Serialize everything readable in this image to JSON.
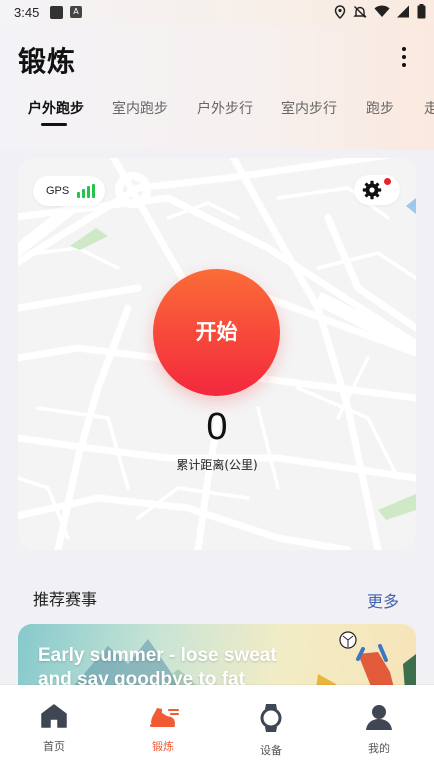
{
  "status_bar": {
    "time": "3:45",
    "icons": [
      "location-icon",
      "notifications-off-icon",
      "wifi-icon",
      "signal-icon",
      "battery-icon"
    ]
  },
  "header": {
    "title": "锻炼",
    "menu_icon": "more-vertical-icon"
  },
  "tabs": [
    {
      "label": "户外跑步",
      "active": true
    },
    {
      "label": "室内跑步",
      "active": false
    },
    {
      "label": "户外步行",
      "active": false
    },
    {
      "label": "室内步行",
      "active": false
    },
    {
      "label": "跑步",
      "active": false
    },
    {
      "label": "走",
      "active": false
    }
  ],
  "map_card": {
    "gps_label": "GPS",
    "gps_signal_bars": 4,
    "settings_has_notification": true,
    "start_label": "开始",
    "distance_value": "0",
    "distance_label": "累计距离(公里)"
  },
  "recommended": {
    "title": "推荐赛事",
    "more_label": "更多",
    "banner_text": "Early summer - lose sweat and say goodbye to fat"
  },
  "bottom_nav": [
    {
      "label": "首页",
      "icon": "home-icon",
      "active": false
    },
    {
      "label": "锻炼",
      "icon": "running-shoe-icon",
      "active": true
    },
    {
      "label": "设备",
      "icon": "watch-icon",
      "active": false
    },
    {
      "label": "我的",
      "icon": "profile-icon",
      "active": false
    }
  ],
  "colors": {
    "accent": "#f25a33",
    "start_gradient_top": "#fb6c37",
    "start_gradient_bottom": "#f3283e",
    "gps_green": "#27c24c",
    "link_blue": "#4562b0",
    "notification_red": "#e8232e"
  }
}
